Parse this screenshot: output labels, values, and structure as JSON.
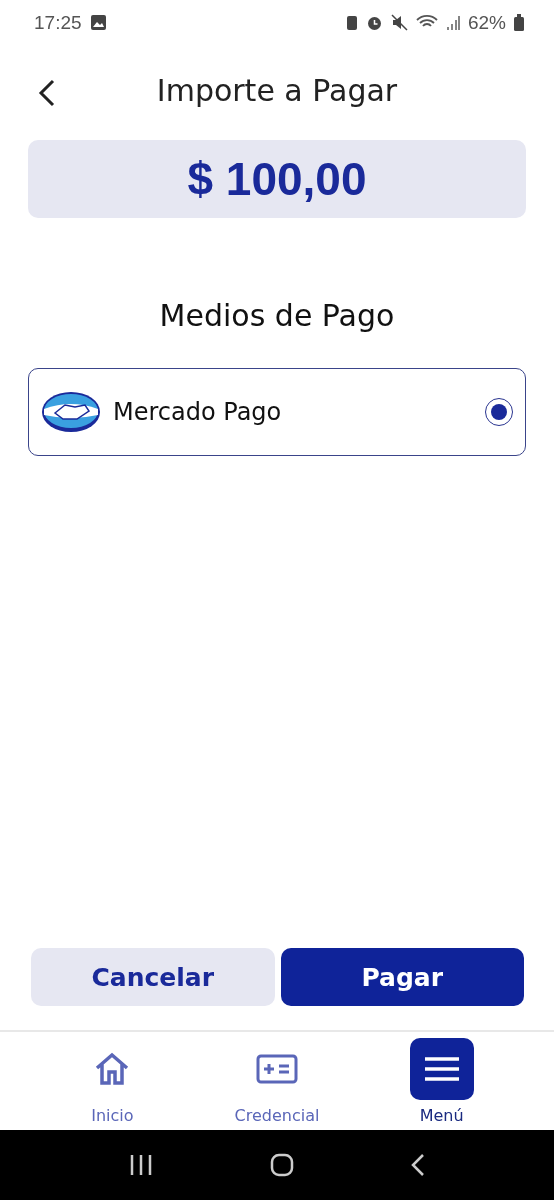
{
  "status_bar": {
    "time": "17:25",
    "battery": "62%"
  },
  "header": {
    "title": "Importe a Pagar"
  },
  "amount": "$ 100,00",
  "section_title": "Medios de Pago",
  "payment_methods": [
    {
      "label": "Mercado Pago",
      "selected": true
    }
  ],
  "buttons": [
    {
      "label": "Cancelar",
      "kind": "secondary"
    },
    {
      "label": "Pagar",
      "kind": "primary"
    }
  ],
  "bottom_nav": [
    {
      "label": "Inicio",
      "kind": "home",
      "selected": false
    },
    {
      "label": "Credencial",
      "kind": "card",
      "selected": false
    },
    {
      "label": "Menú",
      "kind": "menu",
      "selected": true
    }
  ]
}
